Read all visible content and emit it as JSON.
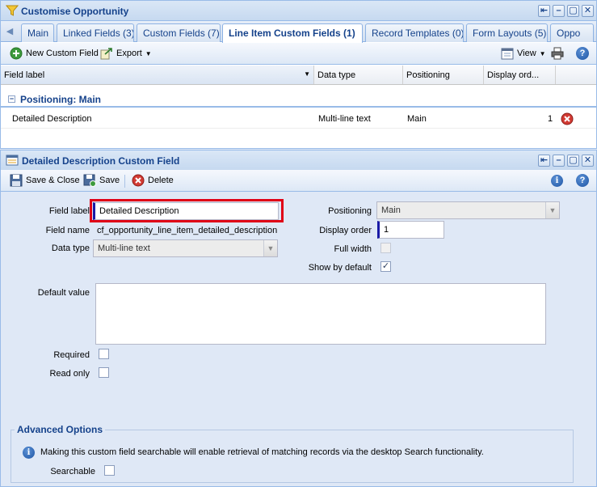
{
  "top_window": {
    "title": "Customise Opportunity",
    "tabs": [
      {
        "label": "Main"
      },
      {
        "label": "Linked Fields (3)"
      },
      {
        "label": "Custom Fields (7)"
      },
      {
        "label": "Line Item Custom Fields (1)",
        "active": true
      },
      {
        "label": "Record Templates (0)"
      },
      {
        "label": "Form Layouts (5)"
      },
      {
        "label": "Oppo"
      }
    ],
    "toolbar": {
      "new_label": "New Custom Field",
      "export_label": "Export",
      "view_label": "View"
    },
    "grid": {
      "columns": [
        "Field label",
        "Data type",
        "Positioning",
        "Display ord..."
      ],
      "group_title": "Positioning: Main",
      "rows": [
        {
          "label": "Detailed Description",
          "data_type": "Multi-line text",
          "positioning": "Main",
          "display_order": "1"
        }
      ]
    }
  },
  "bottom_window": {
    "title": "Detailed Description Custom Field",
    "toolbar": {
      "save_close_label": "Save & Close",
      "save_label": "Save",
      "delete_label": "Delete"
    },
    "form": {
      "field_label_label": "Field label",
      "field_label_value": "Detailed Description",
      "field_name_label": "Field name",
      "field_name_value": "cf_opportunity_line_item_detailed_description",
      "data_type_label": "Data type",
      "data_type_value": "Multi-line text",
      "positioning_label": "Positioning",
      "positioning_value": "Main",
      "display_order_label": "Display order",
      "display_order_value": "1",
      "full_width_label": "Full width",
      "show_by_default_label": "Show by default",
      "default_value_label": "Default value",
      "required_label": "Required",
      "read_only_label": "Read only",
      "advanced_title": "Advanced Options",
      "searchable_info": "Making this custom field searchable will enable retrieval of matching records via the desktop Search functionality.",
      "searchable_label": "Searchable"
    }
  },
  "colors": {
    "title_text": "#15428b",
    "highlight": "#e00016",
    "required_marker": "#1a1aa6",
    "panel_bg": "#dfe8f6"
  }
}
